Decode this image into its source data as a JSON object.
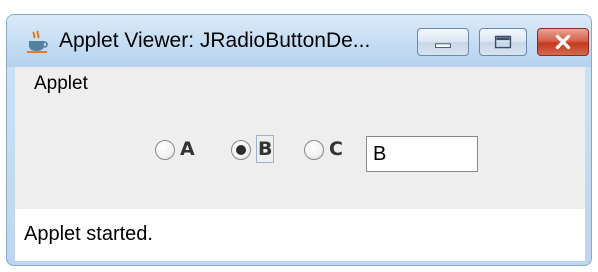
{
  "window": {
    "title": "Applet Viewer: JRadioButtonDe...",
    "icon": "java-cup-icon",
    "controls": {
      "minimize": "minimize-icon",
      "maximize": "maximize-icon",
      "close": "close-icon"
    }
  },
  "menu": {
    "applet_label": "Applet"
  },
  "radios": [
    {
      "label": "A",
      "selected": false
    },
    {
      "label": "B",
      "selected": true
    },
    {
      "label": "C",
      "selected": false
    }
  ],
  "text_field": {
    "value": "B"
  },
  "status": {
    "text": "Applet started."
  },
  "colors": {
    "close_button": "#c4391f",
    "titlebar": "#c5ddf3",
    "content_bg": "#eeeeee"
  }
}
